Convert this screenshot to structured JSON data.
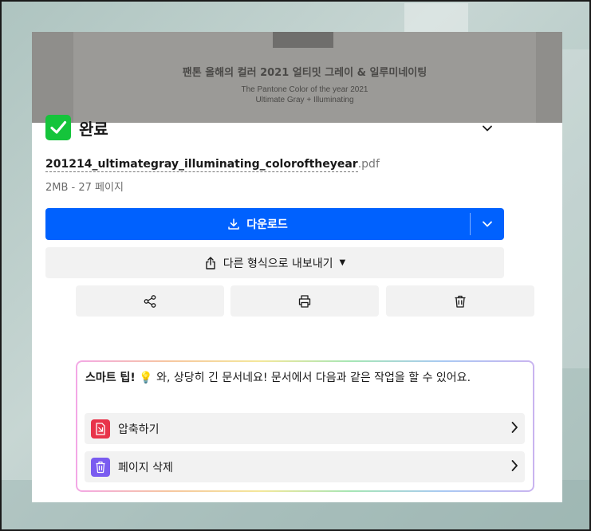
{
  "preview": {
    "title": "팬톤 올해의 컬러 2021 얼티밋 그레이 & 일루미네이팅",
    "subtitle_line1": "The Pantone Color of the year 2021",
    "subtitle_line2": "Ultimate Gray + Illuminating"
  },
  "status": {
    "label": "완료",
    "icon": "checkmark-icon",
    "color": "#15c43b"
  },
  "file": {
    "name": "201214_ultimategray_illuminating_coloroftheyear",
    "extension": ".pdf",
    "meta": "2MB - 27 페이지"
  },
  "actions": {
    "download_label": "다운로드",
    "export_label": "다른 형식으로 내보내기",
    "share_icon": "share-icon",
    "print_icon": "printer-icon",
    "delete_icon": "trash-icon",
    "accent": "#0061fe"
  },
  "tip": {
    "heading": "스마트 팁!",
    "bulb": "💡",
    "message": " 와, 상당히 긴 문서네요! 문서에서 다음과 같은 작업을 할 수 있어요.",
    "items": [
      {
        "label": "압축하기",
        "icon": "compress-icon",
        "color": "#e8344a"
      },
      {
        "label": "페이지 삭제",
        "icon": "trash-icon",
        "color": "#7a5cf0"
      }
    ]
  }
}
